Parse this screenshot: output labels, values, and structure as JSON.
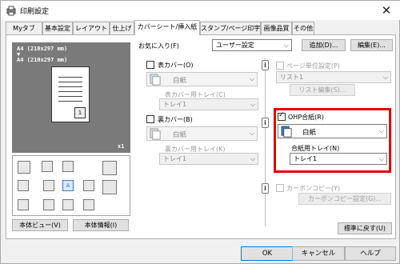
{
  "window": {
    "title": "印刷設定",
    "close_glyph": "✕"
  },
  "tabs": [
    "Myタブ",
    "基本設定",
    "レイアウト",
    "仕上げ",
    "カバーシート/挿入紙",
    "スタンプ/ページ印字",
    "画像品質",
    "その他"
  ],
  "favorites": {
    "label": "お気に入り(F)",
    "value": "ユーザー設定",
    "add_label": "追加(D)...",
    "edit_label": "編集(E)..."
  },
  "preview": {
    "size_line1": "A4 (210x297 mm)",
    "arrow": "▼",
    "size_line2": "A4 (210x297 mm)",
    "copies": "x1"
  },
  "left_buttons": {
    "view": "本体ビュー(V)",
    "info": "本体情報(I)"
  },
  "front_cover": {
    "label": "表カバー(O)",
    "paper": "白紙",
    "tray_label": "表カバー用トレイ(C)",
    "tray": "トレイ1"
  },
  "back_cover": {
    "label": "裏カバー(B)",
    "paper": "白紙",
    "tray_label": "裏カバー用トレイ(K)",
    "tray": "トレイ1"
  },
  "page_unit": {
    "label": "ページ単位設定(P)",
    "list": "リスト1",
    "edit": "リスト編集(S)..."
  },
  "ohp": {
    "label": "OHP合紙(R)",
    "paper": "白紙",
    "tray_label": "合紙用トレイ(N)",
    "tray": "トレイ1"
  },
  "carbon": {
    "label": "カーボンコピー(Y)",
    "setting": "カーボンコピー設定(G)..."
  },
  "restore_label": "標準に戻す(U)",
  "footer": {
    "ok": "OK",
    "cancel": "キャンセル",
    "help": "ヘルプ"
  },
  "colors": {
    "accent": "#0078d7",
    "highlight": "#e00000"
  }
}
